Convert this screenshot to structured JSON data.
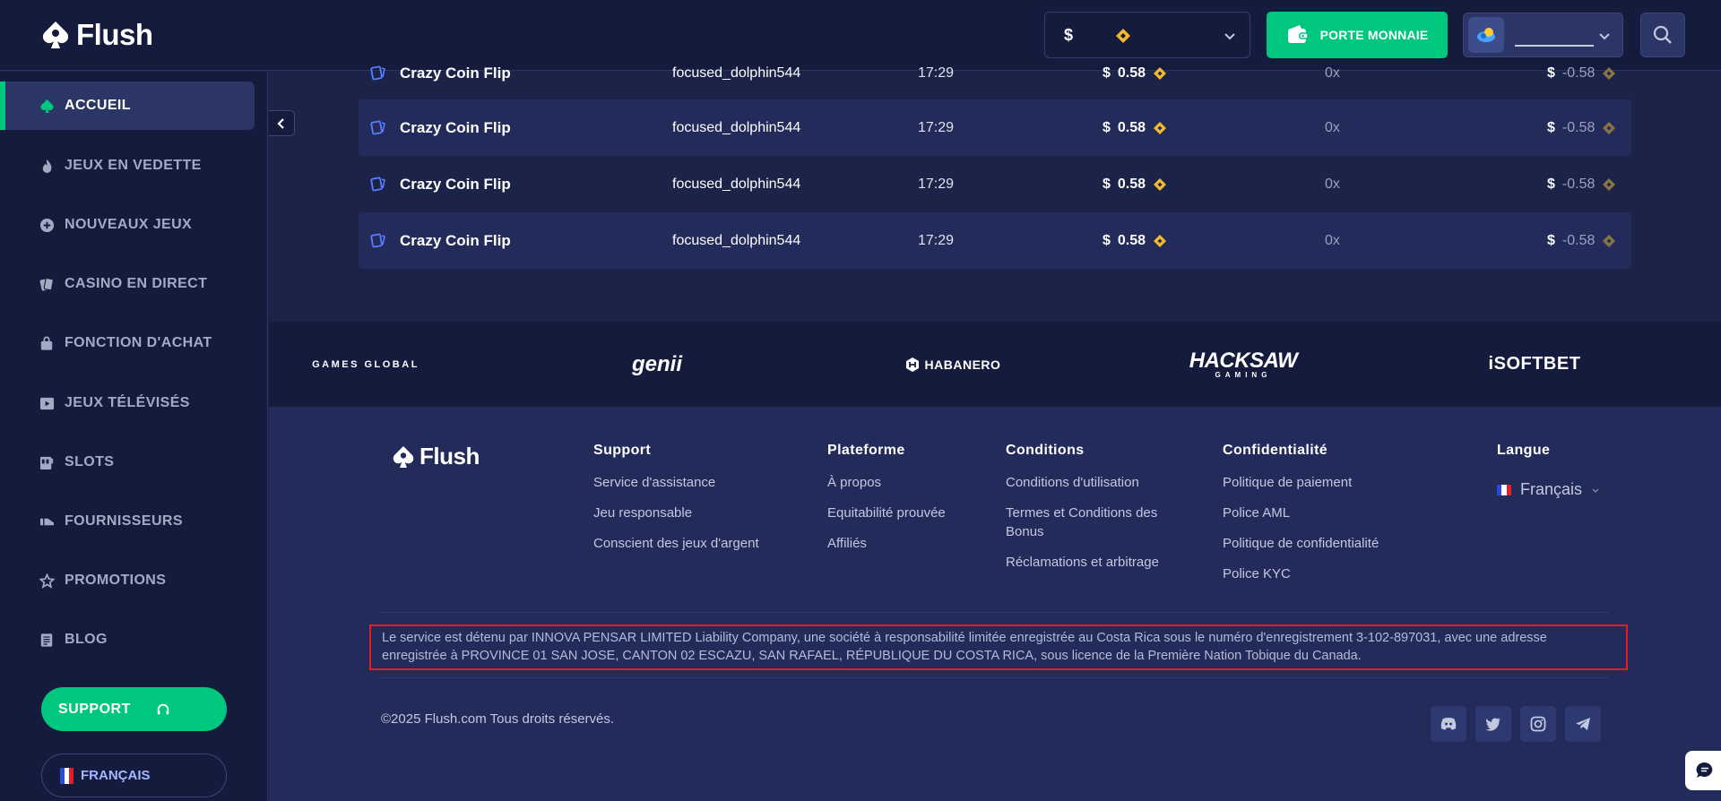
{
  "header": {
    "logo_text": "Flush",
    "currency_symbol": "$",
    "wallet_label": "PORTE MONNAIE",
    "accent_color": "#00c77e"
  },
  "sidebar": {
    "items": [
      {
        "label": "ACCUEIL",
        "icon": "spade-icon"
      },
      {
        "label": "JEUX EN VEDETTE",
        "icon": "flame-icon"
      },
      {
        "label": "NOUVEAUX JEUX",
        "icon": "plus-circle-icon"
      },
      {
        "label": "CASINO EN DIRECT",
        "icon": "cards-icon"
      },
      {
        "label": "FONCTION D'ACHAT",
        "icon": "shopping-bag-icon"
      },
      {
        "label": "JEUX TÉLÉVISÉS",
        "icon": "tv-play-icon"
      },
      {
        "label": "SLOTS",
        "icon": "slot-machine-icon"
      },
      {
        "label": "FOURNISSEURS",
        "icon": "provider-icon"
      },
      {
        "label": "PROMOTIONS",
        "icon": "star-icon"
      },
      {
        "label": "BLOG",
        "icon": "document-icon"
      }
    ],
    "support_label": "SUPPORT",
    "language_label": "FRANÇAIS"
  },
  "bets": {
    "rows": [
      {
        "game": "Crazy Coin Flip",
        "user": "focused_dolphin544",
        "time": "17:29",
        "currency": "$",
        "amount": "0.58",
        "multiplier": "0x",
        "payout": "-0.58"
      },
      {
        "game": "Crazy Coin Flip",
        "user": "focused_dolphin544",
        "time": "17:29",
        "currency": "$",
        "amount": "0.58",
        "multiplier": "0x",
        "payout": "-0.58"
      },
      {
        "game": "Crazy Coin Flip",
        "user": "focused_dolphin544",
        "time": "17:29",
        "currency": "$",
        "amount": "0.58",
        "multiplier": "0x",
        "payout": "-0.58"
      },
      {
        "game": "Crazy Coin Flip",
        "user": "focused_dolphin544",
        "time": "17:29",
        "currency": "$",
        "amount": "0.58",
        "multiplier": "0x",
        "payout": "-0.58"
      }
    ]
  },
  "providers": [
    {
      "name": "GAMES GLOBAL"
    },
    {
      "name": "genii"
    },
    {
      "name": "HABANERO"
    },
    {
      "name": "HACKSAW",
      "sub": "GAMING"
    },
    {
      "name": "iSOFTBET"
    }
  ],
  "footer": {
    "logo_text": "Flush",
    "columns": [
      {
        "title": "Support",
        "links": [
          "Service d'assistance",
          "Jeu responsable",
          "Conscient des jeux d'argent"
        ]
      },
      {
        "title": "Plateforme",
        "links": [
          "À propos",
          "Equitabilité prouvée",
          "Affiliés"
        ]
      },
      {
        "title": "Conditions",
        "links": [
          "Conditions d'utilisation",
          "Termes et Conditions des Bonus",
          "Réclamations et arbitrage"
        ]
      },
      {
        "title": "Confidentialité",
        "links": [
          "Politique de paiement",
          "Police AML",
          "Politique de confidentialité",
          "Police KYC"
        ]
      }
    ],
    "language_title": "Langue",
    "language_value": "Français",
    "legal_text": "Le service est détenu par INNOVA PENSAR LIMITED Liability Company, une société à responsabilité limitée enregistrée au Costa Rica sous le numéro d'enregistrement 3-102-897031, avec une adresse enregistrée à PROVINCE 01 SAN JOSE, CANTON 02 ESCAZU, SAN RAFAEL, RÉPUBLIQUE DU COSTA RICA, sous licence de la Première Nation Tobique du Canada.",
    "copyright": "©2025 Flush.com Tous droits réservés.",
    "socials": [
      "discord-icon",
      "twitter-icon",
      "instagram-icon",
      "telegram-icon"
    ]
  }
}
